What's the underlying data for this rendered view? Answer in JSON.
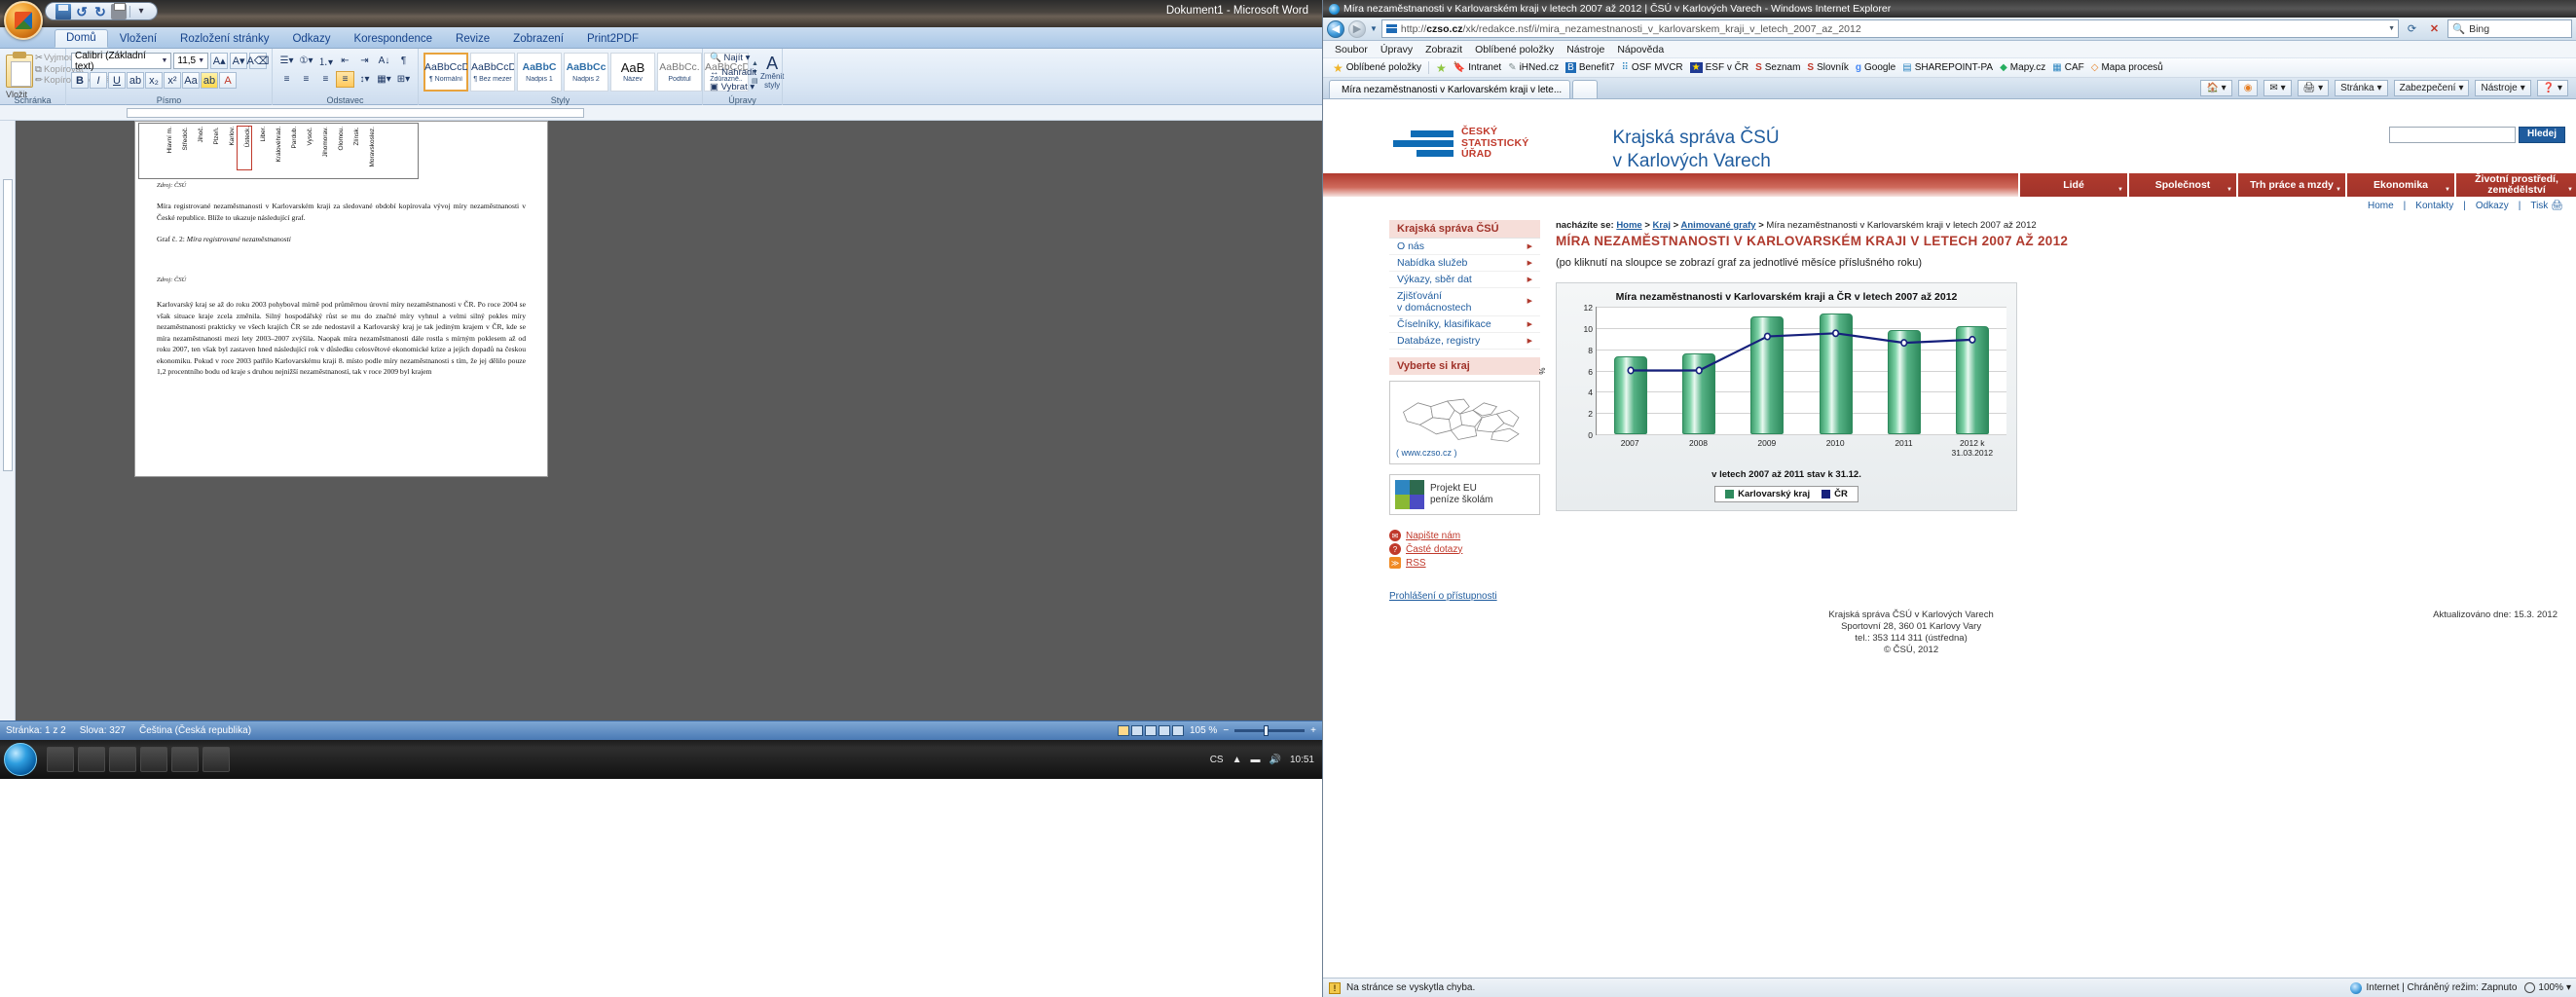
{
  "word": {
    "title": "Dokument1 - Microsoft Word",
    "qat": {
      "save": "save-icon",
      "undo": "undo-icon",
      "redo": "redo-icon",
      "print": "print-icon",
      "more": "more-icon"
    },
    "tabs": [
      "Domů",
      "Vložení",
      "Rozložení stránky",
      "Odkazy",
      "Korespondence",
      "Revize",
      "Zobrazení",
      "Print2PDF"
    ],
    "active_tab": "Domů",
    "groups": {
      "clipboard": {
        "label": "Schránka",
        "paste": "Vložit",
        "cut": "Vyjmout",
        "copy": "Kopírovat",
        "format_painter": "Kopírovat formát"
      },
      "font": {
        "label": "Písmo",
        "font_name": "Calibri (Základní text)",
        "font_size": "11,5"
      },
      "paragraph": {
        "label": "Odstavec"
      },
      "styles": {
        "label": "Styly",
        "items": [
          {
            "sample": "AaBbCcDc",
            "name": "¶ Normální"
          },
          {
            "sample": "AaBbCcDc",
            "name": "¶ Bez mezer"
          },
          {
            "sample": "AaBbC",
            "name": "Nadpis 1"
          },
          {
            "sample": "AaBbCc",
            "name": "Nadpis 2"
          },
          {
            "sample": "AaB",
            "name": "Název"
          },
          {
            "sample": "AaBbCc.",
            "name": "Podtitul"
          },
          {
            "sample": "AaBbCcDc",
            "name": "Zdůrazně.."
          }
        ],
        "change_styles": "Změnit styly"
      },
      "editing": {
        "label": "Úpravy",
        "find": "Najít",
        "replace": "Nahradit",
        "select": "Vybrat"
      }
    },
    "document": {
      "minichart_labels": [
        "Hlavní m.",
        "Středoč.",
        "Jihoč.",
        "Plzeň.",
        "Karlov.",
        "Ústeck.",
        "Liber.",
        "Královéhrad.",
        "Pardub.",
        "Vysoč.",
        "Jihomorav.",
        "Olomou.",
        "Zlínsk.",
        "Moravskoslez."
      ],
      "highlighted_label": "Karlov.",
      "source1": "Zdroj: ČSÚ",
      "para1": "Míra registrované nezaměstnanosti v Karlovarském kraji za sledované období kopírovala vývoj míry nezaměstnanosti v České republice. Blíže to ukazuje následující graf.",
      "graf_prefix": "Graf č. 2: ",
      "graf_title": "Míra registrované nezaměstnanosti",
      "source2": "Zdroj: ČSÚ",
      "para2": "Karlovarský kraj se až do roku 2003 pohyboval mírně pod průměrnou úrovní míry nezaměstnanosti v ČR. Po roce 2004 se však situace kraje zcela změnila. Silný hospodářský růst se mu do značné míry vyhnul a velmi silný pokles míry nezaměstnanosti prakticky ve všech krajích ČR se zde nedostavil a Karlovarský kraj je tak jediným krajem v ČR, kde se míra nezaměstnanosti mezi lety 2003–2007 zvýšila. Naopak míra nezaměstnanosti dále rostla s mírným poklesem až od roku 2007, ten však byl zastaven hned následující rok v důsledku celosvětové ekonomické krize a jejích dopadů na českou ekonomiku. Pokud v roce 2003 patřilo Karlovarskému kraji 8. místo podle míry nezaměstnanosti s tím, že jej dělilo pouze 1,2 procentního bodu od kraje s druhou nejnižší nezaměstnaností, tak v roce 2009 byl krajem"
    },
    "status": {
      "page": "Stránka: 1 z 2",
      "words": "Slova: 327",
      "language": "Čeština (Česká republika)",
      "zoom": "105 %"
    },
    "taskbar": {
      "time": "10:51",
      "lang": "CS"
    }
  },
  "ie": {
    "window_title": "Míra nezaměstnanosti v Karlovarském kraji v letech 2007 až 2012 | ČSÚ v Karlových Varech - Windows Internet Explorer",
    "url_prefix": "http://",
    "url_bold": "czso.cz",
    "url_rest": "/xk/redakce.nsf/i/mira_nezamestnanosti_v_karlovarskem_kraji_v_letech_2007_az_2012",
    "search_engine": "Bing",
    "search_placeholder": "Bing",
    "nav": {
      "back": "back-icon",
      "forward": "forward-icon",
      "refresh": "refresh-icon",
      "stop": "stop-icon"
    },
    "menus": [
      "Soubor",
      "Úpravy",
      "Zobrazit",
      "Oblíbené položky",
      "Nástroje",
      "Nápověda"
    ],
    "favorites_label": "Oblíbené položky",
    "favorites": [
      "Intranet",
      "iHNed.cz",
      "Benefit7",
      "OSF MVCR",
      "ESF v ČR",
      "Seznam",
      "Slovník",
      "Google",
      "SHAREPOINT-PA",
      "Mapy.cz",
      "CAF",
      "Mapa procesů"
    ],
    "tab_label": "Míra nezaměstnanosti v Karlovarském kraji v lete...",
    "toolbar_right": [
      "Stránka",
      "Zabezpečení",
      "Nástroje"
    ],
    "status": {
      "error": "Na stránce se vyskytla chyba.",
      "zone": "Internet | Chráněný režim: Zapnuto",
      "zoom": "100%"
    }
  },
  "site": {
    "logo_lines": [
      "ČESKÝ",
      "STATISTICKÝ",
      "ÚŘAD"
    ],
    "title_line1": "Krajská správa ČSÚ",
    "title_line2": "v Karlových Varech",
    "search_button": "Hledej",
    "search_value": "",
    "topnav": [
      "Lidé",
      "Společnost",
      "Trh práce a mzdy",
      "Ekonomika",
      "Životní prostředí, zemědělství"
    ],
    "utilnav": [
      "Home",
      "Kontakty",
      "Odkazy",
      "Tisk"
    ],
    "sidebar": {
      "heading": "Krajská správa ČSÚ",
      "items": [
        "O nás",
        "Nabídka služeb",
        "Výkazy, sběr dat",
        "Zjišťování\n   v domácnostech",
        "Číselníky, klasifikace",
        "Databáze, registry"
      ],
      "region_heading": "Vyberte si kraj",
      "map_link": "( www.czso.cz )",
      "eu_line1": "Projekt EU",
      "eu_line2": "peníze školám",
      "contacts": [
        "Napište nám",
        "Časté dotazy",
        "RSS"
      ]
    },
    "breadcrumb": {
      "prefix": "nacházíte se:",
      "links": [
        "Home",
        "Kraj",
        "Animované grafy"
      ],
      "current": "Míra nezaměstnanosti v Karlovarském kraji v letech 2007 až 2012"
    },
    "page_title": "MÍRA NEZAMĚSTNANOSTI V KARLOVARSKÉM KRAJI V LETECH 2007 AŽ 2012",
    "page_note": "(po kliknutí na sloupce se zobrazí graf za jednotlivé měsíce příslušného roku)",
    "accessibility_link": "Prohlášení o přístupnosti",
    "footer_address": [
      "Krajská správa ČSÚ v Karlových Varech",
      "Sportovní 28, 360 01 Karlovy Vary",
      "tel.: 353 114 311 (ústředna)",
      "© ČSÚ, 2012"
    ],
    "footer_updated": "Aktualizováno dne: 15.3. 2012"
  },
  "chart_data": {
    "type": "bar",
    "title": "Míra nezaměstnanosti v Karlovarském kraji a ČR v letech 2007 až 2012",
    "subtitle": "v letech 2007 až 2011 stav k 31.12.",
    "xlabel": "",
    "ylabel": "%",
    "ylim": [
      0,
      12
    ],
    "yticks": [
      0,
      2,
      4,
      6,
      8,
      10,
      12
    ],
    "grid": true,
    "legend_position": "bottom",
    "categories": [
      "2007",
      "2008",
      "2009",
      "2010",
      "2011",
      "2012 k\n31.03.2012"
    ],
    "series": [
      {
        "name": "Karlovarský kraj",
        "type": "bar",
        "color": "#2e8a5d",
        "values": [
          7.3,
          7.6,
          11.1,
          11.4,
          9.8,
          10.2
        ]
      },
      {
        "name": "ČR",
        "type": "line",
        "color": "#16207c",
        "values": [
          6.0,
          6.0,
          9.2,
          9.5,
          8.6,
          8.9
        ]
      }
    ]
  }
}
